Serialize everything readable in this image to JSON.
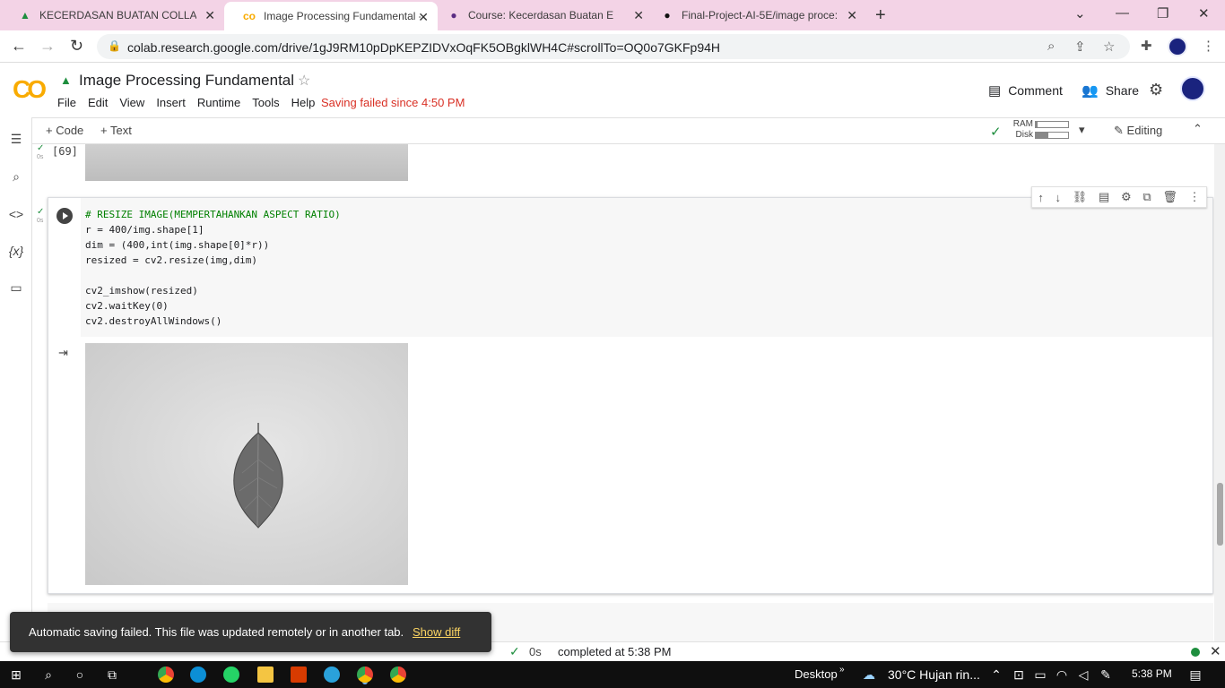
{
  "browser": {
    "tabs": [
      {
        "title": "KECERDASAN BUATAN COLLABS",
        "icon": "google-drive-icon",
        "active": false
      },
      {
        "title": "Image Processing Fundamental -",
        "icon": "colab-icon",
        "active": true
      },
      {
        "title": "Course: Kecerdasan Buatan E",
        "icon": "moodle-icon",
        "active": false
      },
      {
        "title": "Final-Project-AI-5E/image proce:",
        "icon": "github-icon",
        "active": false
      }
    ],
    "url": "colab.research.google.com/drive/1gJ9RM10pDpKEPZIDVxOqFK5OBgklWH4C#scrollTo=OQ0o7GKFp94H"
  },
  "colab": {
    "logo": "CO",
    "title": "Image Processing Fundamental",
    "menu": [
      "File",
      "Edit",
      "View",
      "Insert",
      "Runtime",
      "Tools",
      "Help"
    ],
    "save_status": "Saving failed since 4:50 PM",
    "comment_label": "Comment",
    "share_label": "Share"
  },
  "toolbar": {
    "add_code": "+ Code",
    "add_text": "+ Text",
    "ram_label": "RAM",
    "disk_label": "Disk",
    "ram_fill": 0.05,
    "disk_fill": 0.4,
    "editing_label": "Editing"
  },
  "notebook": {
    "prev_cell": {
      "exec_count": "[69]",
      "duration": "0s"
    },
    "cell": {
      "duration": "0s",
      "code_lines": [
        "# RESIZE IMAGE(MEMPERTAHANKAN ASPECT RATIO)",
        "r = 400/img.shape[1]",
        "dim = (400,int(img.shape[0]*r))",
        "resized = cv2.resize(img,dim)",
        "",
        "cv2_imshow(resized)",
        "cv2.waitKey(0)",
        "cv2.destroyAllWindows()"
      ]
    }
  },
  "snackbar": {
    "message": "Automatic saving failed. This file was updated remotely or in another tab.",
    "action": "Show diff"
  },
  "statusbar": {
    "time": "0s",
    "completed": "completed at 5:38 PM"
  },
  "taskbar": {
    "desktop_label": "Desktop",
    "weather": "30°C  Hujan rin...",
    "clock": "5:38 PM"
  }
}
